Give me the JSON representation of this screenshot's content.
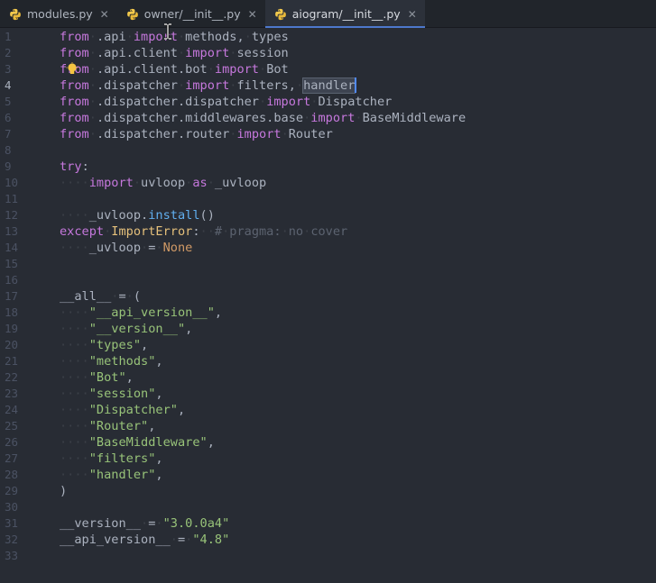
{
  "tabs": [
    {
      "label": "modules.py",
      "close": "✕",
      "active": false
    },
    {
      "label": "owner/__init__.py",
      "close": "✕",
      "active": false
    },
    {
      "label": "aiogram/__init__.py",
      "close": "✕",
      "active": true
    }
  ],
  "current_line": 4,
  "lines": [
    {
      "n": "1",
      "tokens": [
        [
          "kw",
          "from"
        ],
        [
          "",
          "·.api·"
        ],
        [
          "kw",
          "import"
        ],
        [
          "",
          "·methods,·types"
        ]
      ]
    },
    {
      "n": "2",
      "tokens": [
        [
          "kw",
          "from"
        ],
        [
          "",
          "·.api.client·"
        ],
        [
          "kw",
          "import"
        ],
        [
          "",
          "·session"
        ]
      ]
    },
    {
      "n": "3",
      "tokens": [
        [
          "kw",
          "from"
        ],
        [
          "",
          "·.api.client.bot·"
        ],
        [
          "kw",
          "import"
        ],
        [
          "",
          "·Bot"
        ]
      ]
    },
    {
      "n": "4",
      "tokens": [
        [
          "kw",
          "from"
        ],
        [
          "",
          "·.dispatcher·"
        ],
        [
          "kw",
          "import"
        ],
        [
          "",
          "·filters,·"
        ],
        [
          "sel",
          "handler"
        ]
      ]
    },
    {
      "n": "5",
      "tokens": [
        [
          "kw",
          "from"
        ],
        [
          "",
          "·.dispatcher.dispatcher·"
        ],
        [
          "kw",
          "import"
        ],
        [
          "",
          "·Dispatcher"
        ]
      ]
    },
    {
      "n": "6",
      "tokens": [
        [
          "kw",
          "from"
        ],
        [
          "",
          "·.dispatcher.middlewares.base·"
        ],
        [
          "kw",
          "import"
        ],
        [
          "",
          "·BaseMiddleware"
        ]
      ]
    },
    {
      "n": "7",
      "tokens": [
        [
          "kw",
          "from"
        ],
        [
          "",
          "·.dispatcher.router·"
        ],
        [
          "kw",
          "import"
        ],
        [
          "",
          "·Router"
        ]
      ]
    },
    {
      "n": "8",
      "tokens": []
    },
    {
      "n": "9",
      "tokens": [
        [
          "kw",
          "try"
        ],
        [
          "",
          ":"
        ]
      ]
    },
    {
      "n": "10",
      "tokens": [
        [
          "ind",
          "····"
        ],
        [
          "kw",
          "import"
        ],
        [
          "",
          "·uvloop·"
        ],
        [
          "kw",
          "as"
        ],
        [
          "",
          "·_uvloop"
        ]
      ]
    },
    {
      "n": "11",
      "tokens": []
    },
    {
      "n": "12",
      "tokens": [
        [
          "ind",
          "····"
        ],
        [
          "",
          "_uvloop."
        ],
        [
          "fn",
          "install"
        ],
        [
          "",
          "()"
        ]
      ]
    },
    {
      "n": "13",
      "tokens": [
        [
          "kw",
          "except"
        ],
        [
          "",
          "·"
        ],
        [
          "cls",
          "ImportError"
        ],
        [
          "",
          ":··"
        ],
        [
          "cm",
          "#·pragma:·no·cover"
        ]
      ]
    },
    {
      "n": "14",
      "tokens": [
        [
          "ind",
          "····"
        ],
        [
          "",
          "_uvloop·=·"
        ],
        [
          "num",
          "None"
        ]
      ]
    },
    {
      "n": "15",
      "tokens": []
    },
    {
      "n": "16",
      "tokens": []
    },
    {
      "n": "17",
      "tokens": [
        [
          "",
          "__all__·=·("
        ]
      ]
    },
    {
      "n": "18",
      "tokens": [
        [
          "ind",
          "····"
        ],
        [
          "str",
          "\"__api_version__\""
        ],
        [
          "",
          ","
        ]
      ]
    },
    {
      "n": "19",
      "tokens": [
        [
          "ind",
          "····"
        ],
        [
          "str",
          "\"__version__\""
        ],
        [
          "",
          ","
        ]
      ]
    },
    {
      "n": "20",
      "tokens": [
        [
          "ind",
          "····"
        ],
        [
          "str",
          "\"types\""
        ],
        [
          "",
          ","
        ]
      ]
    },
    {
      "n": "21",
      "tokens": [
        [
          "ind",
          "····"
        ],
        [
          "str",
          "\"methods\""
        ],
        [
          "",
          ","
        ]
      ]
    },
    {
      "n": "22",
      "tokens": [
        [
          "ind",
          "····"
        ],
        [
          "str",
          "\"Bot\""
        ],
        [
          "",
          ","
        ]
      ]
    },
    {
      "n": "23",
      "tokens": [
        [
          "ind",
          "····"
        ],
        [
          "str",
          "\"session\""
        ],
        [
          "",
          ","
        ]
      ]
    },
    {
      "n": "24",
      "tokens": [
        [
          "ind",
          "····"
        ],
        [
          "str",
          "\"Dispatcher\""
        ],
        [
          "",
          ","
        ]
      ]
    },
    {
      "n": "25",
      "tokens": [
        [
          "ind",
          "····"
        ],
        [
          "str",
          "\"Router\""
        ],
        [
          "",
          ","
        ]
      ]
    },
    {
      "n": "26",
      "tokens": [
        [
          "ind",
          "····"
        ],
        [
          "str",
          "\"BaseMiddleware\""
        ],
        [
          "",
          ","
        ]
      ]
    },
    {
      "n": "27",
      "tokens": [
        [
          "ind",
          "····"
        ],
        [
          "str",
          "\"filters\""
        ],
        [
          "",
          ","
        ]
      ]
    },
    {
      "n": "28",
      "tokens": [
        [
          "ind",
          "····"
        ],
        [
          "str",
          "\"handler\""
        ],
        [
          "",
          ","
        ]
      ]
    },
    {
      "n": "29",
      "tokens": [
        [
          "",
          ")"
        ]
      ]
    },
    {
      "n": "30",
      "tokens": []
    },
    {
      "n": "31",
      "tokens": [
        [
          "",
          "__version__·=·"
        ],
        [
          "str",
          "\"3.0.0a4\""
        ]
      ]
    },
    {
      "n": "32",
      "tokens": [
        [
          "",
          "__api_version__·=·"
        ],
        [
          "str",
          "\"4.8\""
        ]
      ]
    },
    {
      "n": "33",
      "tokens": []
    }
  ],
  "icons": {
    "file": "python-icon",
    "close": "close-icon",
    "hint": "lightbulb-icon",
    "pointer": "text-cursor-icon"
  },
  "colors": {
    "keyword": "#c678dd",
    "string": "#98c379",
    "function": "#61afef",
    "class": "#e5c07b",
    "constant": "#d19a66",
    "comment": "#5c6370",
    "accent": "#4d78cc"
  }
}
